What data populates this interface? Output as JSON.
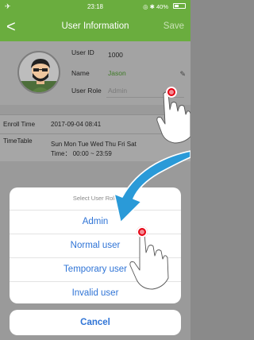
{
  "status_bar": {
    "time": "23:18",
    "indicators": "◎ ✱ 40%",
    "airplane_icon": "airplane-icon",
    "battery_level": 0.4
  },
  "nav": {
    "back_label": "<",
    "title": "User Information",
    "save_label": "Save"
  },
  "user": {
    "id_label": "User ID",
    "id_value": "1000",
    "name_label": "Name",
    "name_value": "Jason",
    "role_label": "User Role",
    "role_value": "Admin"
  },
  "details": {
    "enroll_label": "Enroll Time",
    "enroll_value": "2017-09-04 08:41",
    "timetable_label": "TimeTable",
    "timetable_days": "Sun Mon Tue Wed Thu Fri Sat",
    "timetable_time": "Time： 00:00 ~ 23:59"
  },
  "role_sheet": {
    "header": "Select User Role",
    "options": [
      "Admin",
      "Normal user",
      "Temporary user",
      "Invalid user"
    ],
    "cancel_label": "Cancel"
  },
  "colors": {
    "header_green": "#6aad3e",
    "action_blue": "#2f74d6",
    "tap_red": "#e60012",
    "arrow_blue": "#2a9ad8"
  }
}
